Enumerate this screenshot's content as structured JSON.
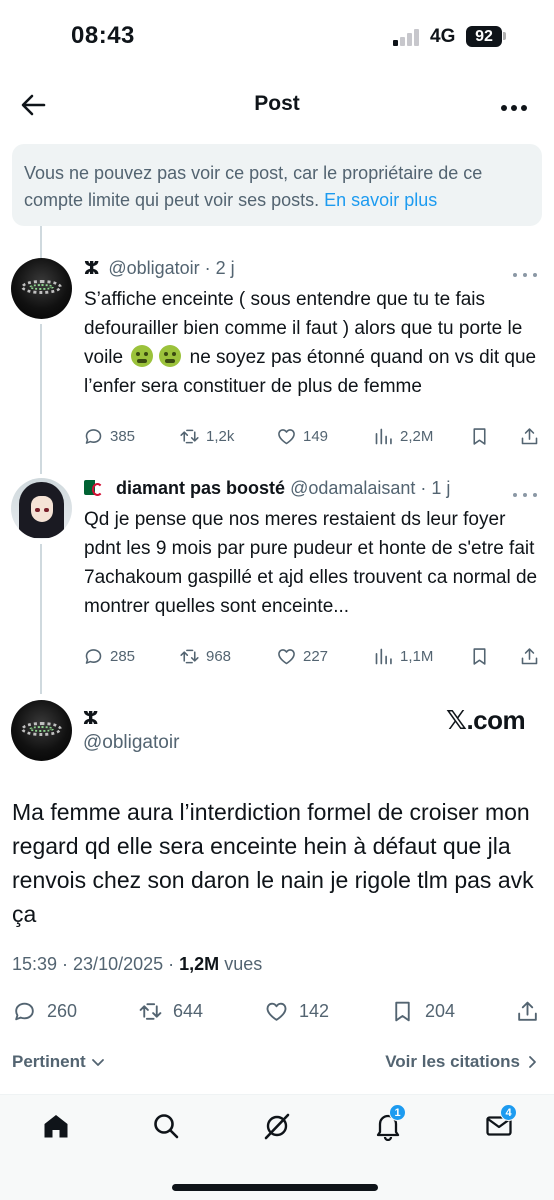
{
  "status_bar": {
    "time": "08:43",
    "network": "4G",
    "battery": "92"
  },
  "header": {
    "title": "Post",
    "back_icon": "arrow-left-icon",
    "more_icon": "more-horizontal-icon"
  },
  "notice": {
    "text": "Vous ne pouvez pas voir ce post, car le propriétaire de ce compte limite qui peut voir ses posts.",
    "link": "En savoir plus"
  },
  "replies": [
    {
      "glyph": "ⵣ",
      "handle": "@obligatoir",
      "time": "· 2 j",
      "text_part1": "S’affiche enceinte ( sous entendre que tu te fais defourailler bien comme il faut ) alors que tu porte le voile",
      "text_part2": "ne soyez pas étonné quand on vs dit que l’enfer sera constituer de plus de femme",
      "replies": "385",
      "reposts": "1,2k",
      "likes": "149",
      "views": "2,2M"
    },
    {
      "display_name": "diamant pas boosté",
      "handle": "@odamalaisant",
      "time": "· 1 j",
      "text": "Qd je pense que nos meres restaient ds leur foyer pdnt les 9 mois par pure pudeur et honte de s'etre fait 7achakoum gaspillé et ajd elles trouvent ca normal de montrer quelles sont enceinte...",
      "replies": "285",
      "reposts": "968",
      "likes": "227",
      "views": "1,1M"
    }
  ],
  "main_post": {
    "glyph": "ⵣ",
    "handle": "@obligatoir",
    "watermark": "𝕏.com",
    "text": "Ma femme aura l’interdiction formel de croiser mon regard qd elle sera enceinte hein à défaut que jla renvois chez son daron le nain je rigole tlm pas avk ça",
    "timestamp": "15:39 · 23/10/2025 ·",
    "views_count": "1,2M",
    "views_label": "vues",
    "replies": "260",
    "reposts": "644",
    "likes": "142",
    "bookmarks": "204"
  },
  "footer": {
    "sort_label": "Pertinent",
    "quotes_label": "Voir les citations"
  },
  "bottom_nav": {
    "items": [
      "home-icon",
      "search-icon",
      "grok-icon",
      "notifications-icon",
      "messages-icon"
    ],
    "notifications_badge": "1",
    "messages_badge": "4"
  },
  "colors": {
    "accent": "#1d9bf0",
    "text": "#0f1419",
    "secondary": "#536471",
    "notice_bg": "#eff3f4"
  }
}
